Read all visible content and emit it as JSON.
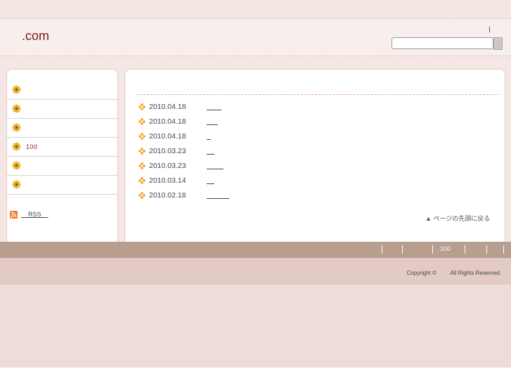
{
  "header": {
    "site_title": ".com",
    "search_placeholder": ""
  },
  "sidebar": {
    "items": [
      {
        "label": "",
        "icon": "sunflower-icon"
      },
      {
        "label": "",
        "icon": "sunflower-icon"
      },
      {
        "label": "",
        "icon": "sunflower-icon"
      },
      {
        "label": "100",
        "icon": "sunflower-icon"
      },
      {
        "label": "",
        "icon": "sunflower-icon"
      },
      {
        "label": "",
        "icon": "sunflower-icon"
      }
    ],
    "rss_label": "RSS",
    "rss_icon": "rss-icon"
  },
  "news": {
    "items": [
      {
        "date": "2010.04.18"
      },
      {
        "date": "2010.04.18"
      },
      {
        "date": "2010.04.18"
      },
      {
        "date": "2010.03.23"
      },
      {
        "date": "2010.03.23"
      },
      {
        "date": "2010.03.14"
      },
      {
        "date": "2010.02.18"
      }
    ],
    "bullet_icon": "clover-bullet-icon",
    "page_top": "▲ ページの先頭に戻る"
  },
  "footer": {
    "nav_center_label": "100",
    "copyright": "Copyright ©       . All Rights Reserved."
  },
  "colors": {
    "accent": "#7a1a1a",
    "nav_bar": "#b79e8e",
    "footer": "#e4cac4",
    "background": "#efdcd8"
  }
}
